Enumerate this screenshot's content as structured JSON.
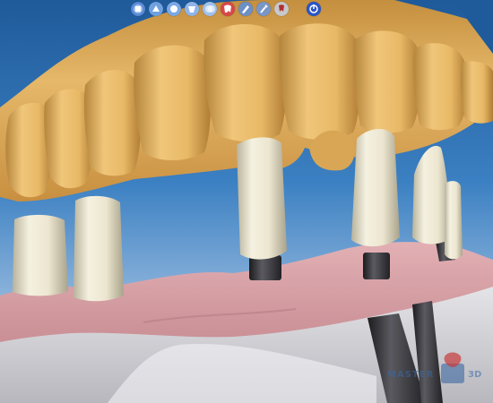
{
  "app": {
    "logo_text": "MASTER3D"
  },
  "toolbar": {
    "buttons": [
      {
        "icon": "view-front-icon",
        "color": "#5a8bd8"
      },
      {
        "icon": "view-side-icon",
        "color": "#6fa0e0"
      },
      {
        "icon": "view-top-icon",
        "color": "#7aa9e6"
      },
      {
        "icon": "view-perspective-icon",
        "color": "#8fb4e8"
      },
      {
        "icon": "transparency-icon",
        "color": "#9fc0ec"
      },
      {
        "icon": "tooth-red-icon",
        "color": "#d64848"
      },
      {
        "icon": "pen-tool-icon",
        "color": "#6c8fc4"
      },
      {
        "icon": "wrench-icon",
        "color": "#7896c8"
      },
      {
        "icon": "tooth-settings-icon",
        "color": "#c8c8cc"
      },
      {
        "icon": "power-icon",
        "color": "#2a55c8"
      }
    ]
  },
  "colors": {
    "background": "#2f6fae",
    "upper_model": "#e6b86a",
    "abutment": "#ece6d0",
    "gingiva": "#d9a4a8",
    "lower_model": "#d2d2d6",
    "implant_shaft": "#3a3a3e"
  }
}
